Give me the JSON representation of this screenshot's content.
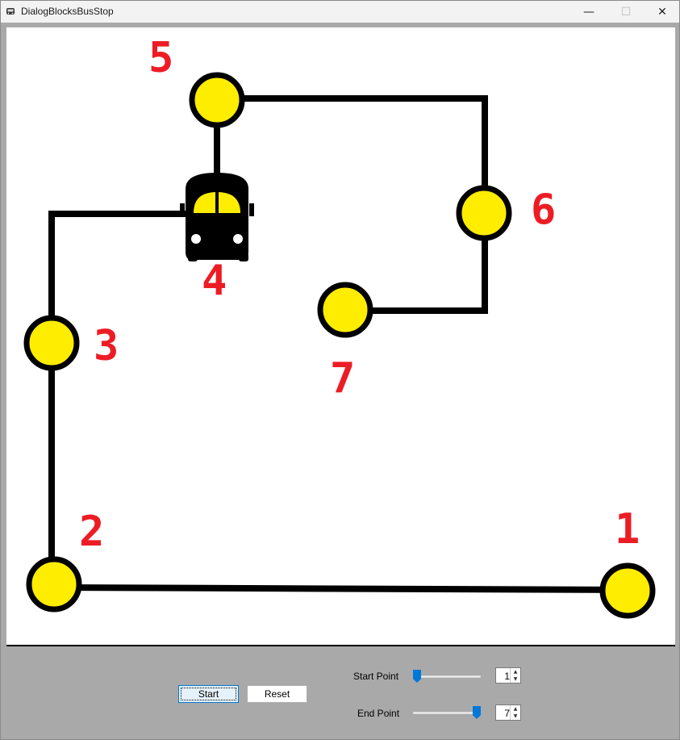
{
  "window": {
    "title": "DialogBlocksBusStop",
    "minimize_glyph": "—",
    "maximize_glyph": "☐",
    "close_glyph": "✕"
  },
  "map": {
    "stops": [
      {
        "id": "1",
        "label": "1"
      },
      {
        "id": "2",
        "label": "2"
      },
      {
        "id": "3",
        "label": "3"
      },
      {
        "id": "4",
        "label": "4"
      },
      {
        "id": "5",
        "label": "5"
      },
      {
        "id": "6",
        "label": "6"
      },
      {
        "id": "7",
        "label": "7"
      }
    ],
    "bus_at_stop": "4",
    "colors": {
      "stop_fill": "#ffed00",
      "stop_stroke": "#000000",
      "route": "#000000",
      "label": "#ed1c24"
    }
  },
  "controls": {
    "start_label": "Start",
    "reset_label": "Reset",
    "start_point_label": "Start Point",
    "end_point_label": "End Point",
    "start_point_value": "1",
    "end_point_value": "7",
    "slider_min": 1,
    "slider_max": 7,
    "accent": "#0078d7",
    "spin_up": "▲",
    "spin_down": "▼"
  }
}
